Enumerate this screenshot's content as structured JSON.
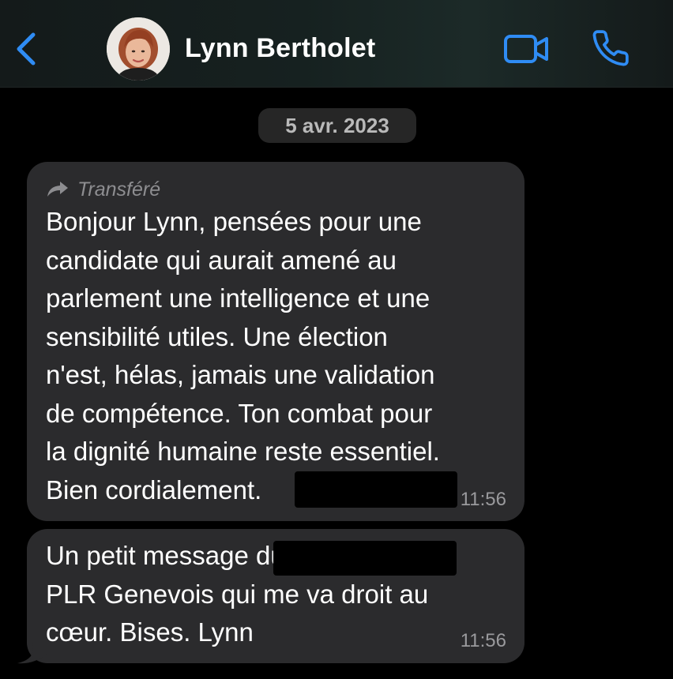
{
  "header": {
    "contact_name": "Lynn Bertholet",
    "back_icon": "chevron-left-icon",
    "video_icon": "video-camera-icon",
    "call_icon": "phone-icon",
    "accent_color": "#2f8cf4"
  },
  "date_separator": "5 avr. 2023",
  "messages": [
    {
      "forwarded_label": "Transféré",
      "text": "Bonjour Lynn, pensées pour une\ncandidate qui aurait amené au\nparlement une intelligence et une\nsensibilité utiles. Une élection\nn'est, hélas, jamais une validation\nde compétence. Ton combat pour\nla dignité humaine reste essentiel.\nBien cordialement.",
      "time": "11:56",
      "redacted": true
    },
    {
      "text": "Un petit message                        du\nPLR Genevois qui me va droit au\ncœur. Bises. Lynn",
      "time": "11:56",
      "redacted": true
    }
  ],
  "colors": {
    "background": "#000000",
    "bubble": "#2b2b2d",
    "date_badge": "#262626",
    "secondary_text": "#9a9a9d"
  }
}
